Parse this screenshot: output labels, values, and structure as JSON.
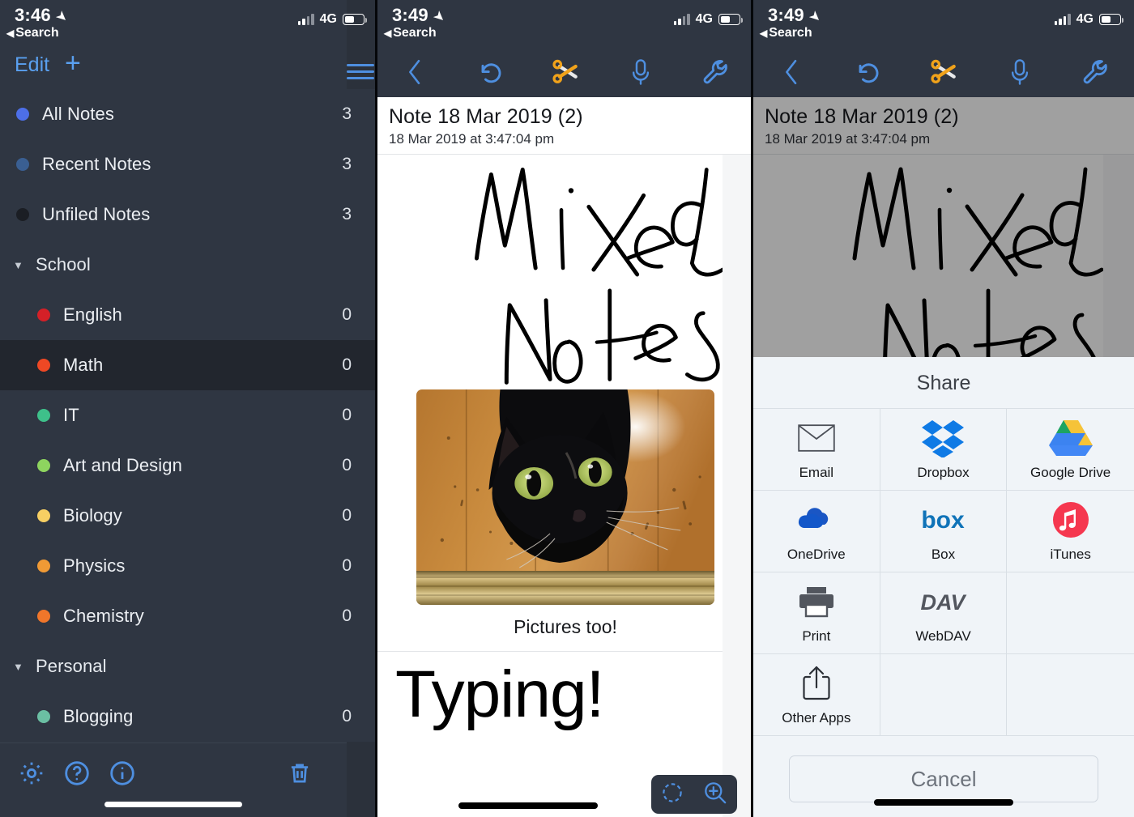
{
  "panel1": {
    "status": {
      "time": "3:46",
      "back": "Search",
      "network": "4G",
      "location_icon": "location-arrow-icon"
    },
    "toolbar": {
      "edit_label": "Edit",
      "add_label": "+",
      "menu_icon": "hamburger-menu-icon"
    },
    "items": [
      {
        "label": "All Notes",
        "count": "3",
        "color": "#4d6fe8",
        "level": 0,
        "type": "item",
        "selected": false
      },
      {
        "label": "Recent Notes",
        "count": "3",
        "color": "#3a5f92",
        "level": 0,
        "type": "item",
        "selected": false
      },
      {
        "label": "Unfiled Notes",
        "count": "3",
        "color": "#1b1e24",
        "level": 0,
        "type": "item",
        "selected": false
      },
      {
        "label": "School",
        "count": "",
        "color": "",
        "level": 0,
        "type": "group",
        "selected": false
      },
      {
        "label": "English",
        "count": "0",
        "color": "#d42027",
        "level": 1,
        "type": "item",
        "selected": false
      },
      {
        "label": "Math",
        "count": "0",
        "color": "#ee4824",
        "level": 1,
        "type": "item",
        "selected": true
      },
      {
        "label": "IT",
        "count": "0",
        "color": "#3ec08a",
        "level": 1,
        "type": "item",
        "selected": false
      },
      {
        "label": "Art and Design",
        "count": "0",
        "color": "#8ed45f",
        "level": 1,
        "type": "item",
        "selected": false
      },
      {
        "label": "Biology",
        "count": "0",
        "color": "#f7cf63",
        "level": 1,
        "type": "item",
        "selected": false
      },
      {
        "label": "Physics",
        "count": "0",
        "color": "#f09a35",
        "level": 1,
        "type": "item",
        "selected": false
      },
      {
        "label": "Chemistry",
        "count": "0",
        "color": "#f0762a",
        "level": 1,
        "type": "item",
        "selected": false
      },
      {
        "label": "Personal",
        "count": "",
        "color": "",
        "level": 0,
        "type": "group",
        "selected": false
      },
      {
        "label": "Blogging",
        "count": "0",
        "color": "#6bbfa3",
        "level": 1,
        "type": "item",
        "selected": false
      }
    ],
    "bottom_tools": [
      "settings-gear-icon",
      "help-question-icon",
      "info-icon",
      "trash-icon"
    ]
  },
  "panel2": {
    "status": {
      "time": "3:49",
      "back": "Search",
      "network": "4G"
    },
    "toolbar": [
      "back-chevron-icon",
      "undo-icon",
      "scissors-icon",
      "microphone-icon",
      "wrench-icon"
    ],
    "note": {
      "title": "Note 18 Mar 2019 (2)",
      "date": "18 Mar 2019 at 3:47:04 pm",
      "handwriting_line1": "Mixed",
      "handwriting_line2": "Notes",
      "image_alt": "black cat on wooden floor",
      "caption": "Pictures too!",
      "typed_text": "Typing!"
    },
    "zoombar": [
      "lasso-select-icon",
      "zoom-in-icon"
    ]
  },
  "panel3": {
    "status": {
      "time": "3:49",
      "back": "Search",
      "network": "4G"
    },
    "toolbar": [
      "back-chevron-icon",
      "undo-icon",
      "scissors-icon",
      "microphone-icon",
      "wrench-icon"
    ],
    "note": {
      "title": "Note 18 Mar 2019 (2)",
      "date": "18 Mar 2019 at 3:47:04 pm",
      "handwriting_line1": "Mixed",
      "handwriting_line2": "Notes"
    },
    "share": {
      "title": "Share",
      "items": [
        {
          "label": "Email",
          "icon": "envelope-icon"
        },
        {
          "label": "Dropbox",
          "icon": "dropbox-icon"
        },
        {
          "label": "Google Drive",
          "icon": "google-drive-icon"
        },
        {
          "label": "OneDrive",
          "icon": "onedrive-cloud-icon"
        },
        {
          "label": "Box",
          "icon": "box-icon"
        },
        {
          "label": "iTunes",
          "icon": "itunes-icon"
        },
        {
          "label": "Print",
          "icon": "printer-icon"
        },
        {
          "label": "WebDAV",
          "icon": "webdav-icon"
        },
        {
          "label": "",
          "icon": ""
        },
        {
          "label": "Other Apps",
          "icon": "share-upload-icon"
        },
        {
          "label": "",
          "icon": ""
        },
        {
          "label": "",
          "icon": ""
        }
      ],
      "cancel_label": "Cancel"
    }
  },
  "colors": {
    "sidebar_bg": "#2f3642",
    "sidebar_selected": "#22262e",
    "accent_blue": "#4e8fe0",
    "sheet_bg": "#f0f4f8",
    "dim_overlay": "#a0a0a0"
  }
}
